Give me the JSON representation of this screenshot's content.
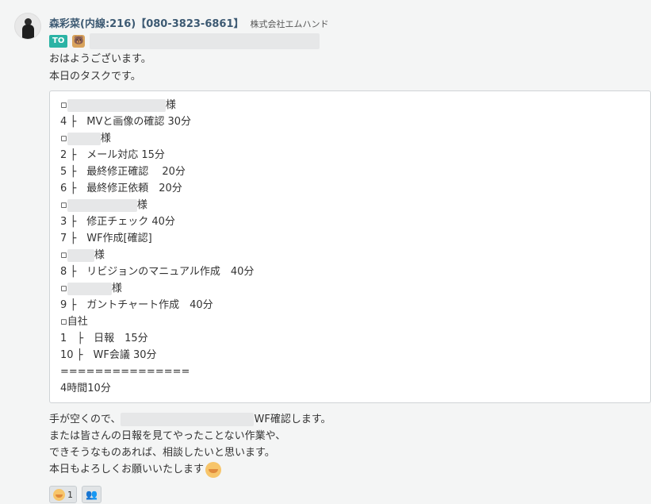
{
  "message": {
    "sender": "森彩菜(内線:216)【080-3823-6861】",
    "company": "株式会社エムハンド",
    "to_label": "TO",
    "to_icon": "🐻",
    "greeting": "おはようございます。",
    "intro": "本日のタスクです。",
    "quote_lines": [
      {
        "text": "▫",
        "blur": 124,
        "suffix": "様"
      },
      {
        "text": "4 ├　MVと画像の確認 30分"
      },
      {
        "text": "▫",
        "blur": 42,
        "suffix": "様"
      },
      {
        "text": "2 ├　メール対応 15分"
      },
      {
        "text": "5 ├　最終修正確認　 20分"
      },
      {
        "text": "6 ├　最終修正依頼　20分"
      },
      {
        "text": "▫",
        "blur": 88,
        "suffix": "様"
      },
      {
        "text": "3 ├　修正チェック 40分"
      },
      {
        "text": "7 ├　WF作成[確認]"
      },
      {
        "text": "▫",
        "blur": 34,
        "suffix": "様"
      },
      {
        "text": "8 ├　リビジョンのマニュアル作成　40分"
      },
      {
        "text": "▫",
        "blur": 56,
        "suffix": "様"
      },
      {
        "text": "9 ├　ガントチャート作成　40分"
      },
      {
        "text": "▫自社"
      },
      {
        "text": "1　├　日報　15分"
      },
      {
        "text": "10 ├　WF会議 30分"
      },
      {
        "text": "==============="
      },
      {
        "text": "4時間10分"
      }
    ],
    "after_lines": [
      {
        "prefix": "手が空くので、",
        "blur": 168,
        "suffix": "WF確認します。"
      },
      {
        "prefix": "または皆さんの日報を見てやったことない作業や、"
      },
      {
        "prefix": "できそうなものあれば、相談したいと思います。"
      },
      {
        "prefix": "本日もよろしくお願いいたします",
        "emoji": true
      }
    ],
    "reactions": [
      {
        "emoji": "bow-emoji",
        "count": "1"
      },
      {
        "emoji": "user-add-icon",
        "count": ""
      }
    ]
  }
}
